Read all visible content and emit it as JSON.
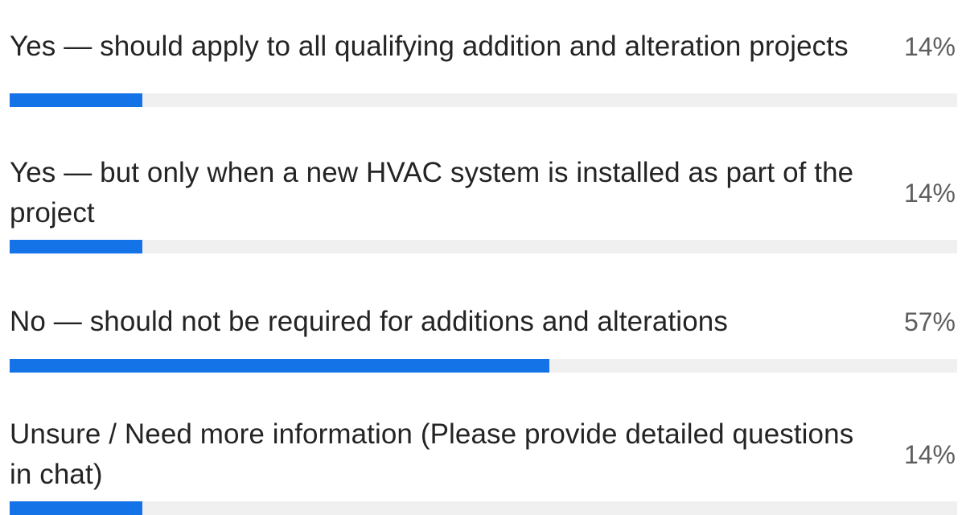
{
  "poll": {
    "options": [
      {
        "label": "Yes — should apply to all qualifying addition and alteration projects",
        "percent": "14%",
        "fraction": 0.14
      },
      {
        "label": "Yes — but only when a new HVAC system is installed as part of the project",
        "percent": "14%",
        "fraction": 0.14
      },
      {
        "label": "No — should not be required for additions and alterations",
        "percent": "57%",
        "fraction": 0.57
      },
      {
        "label": "Unsure / Need more information (Please provide detailed questions in chat)",
        "percent": "14%",
        "fraction": 0.14
      }
    ],
    "colors": {
      "bar_fill": "#1473e6",
      "bar_track": "#f0f0f0"
    }
  }
}
